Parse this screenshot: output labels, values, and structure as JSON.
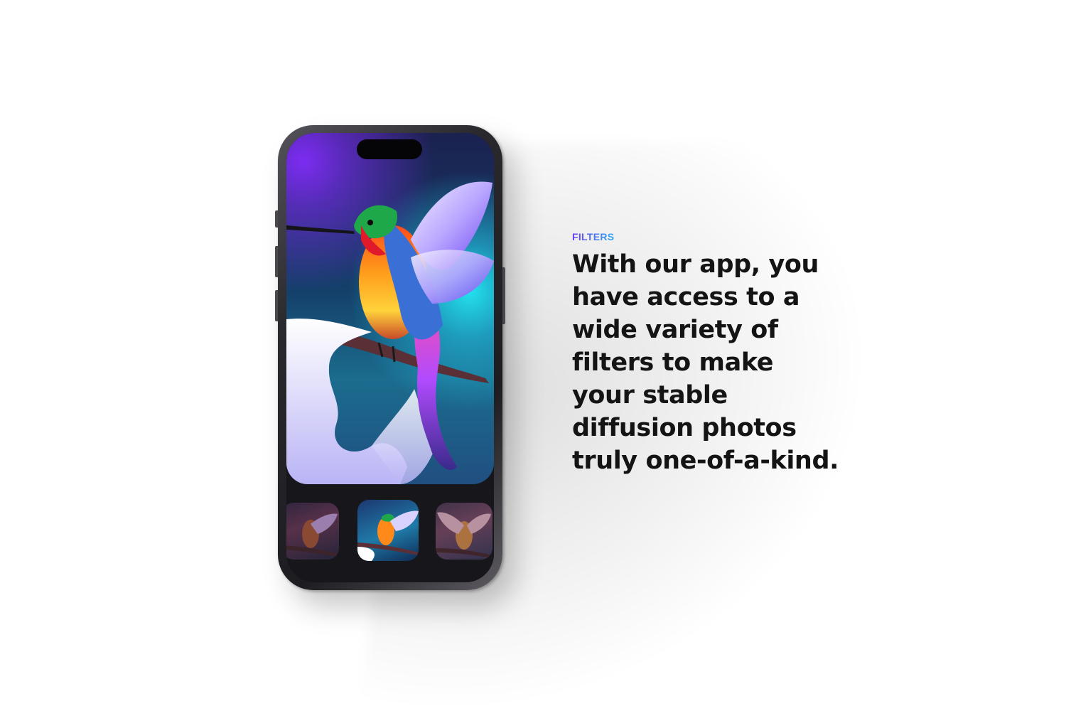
{
  "hero": {
    "eyebrow": "FILTERS",
    "headline": "With our app, you have access to a wide variety of filters to make your stable diffusion photos truly one-of-a-kind."
  },
  "phone": {
    "main_image": "hummingbird-on-snowy-branch",
    "thumbnails": [
      {
        "name": "filter-thumbnail-1",
        "selected": false
      },
      {
        "name": "filter-thumbnail-2",
        "selected": true
      },
      {
        "name": "filter-thumbnail-3",
        "selected": false
      }
    ]
  },
  "colors": {
    "eyebrow_gradient_start": "#6a3df0",
    "eyebrow_gradient_end": "#2fa7f2",
    "headline": "#141414",
    "phone_frame": "#1d1c20"
  }
}
